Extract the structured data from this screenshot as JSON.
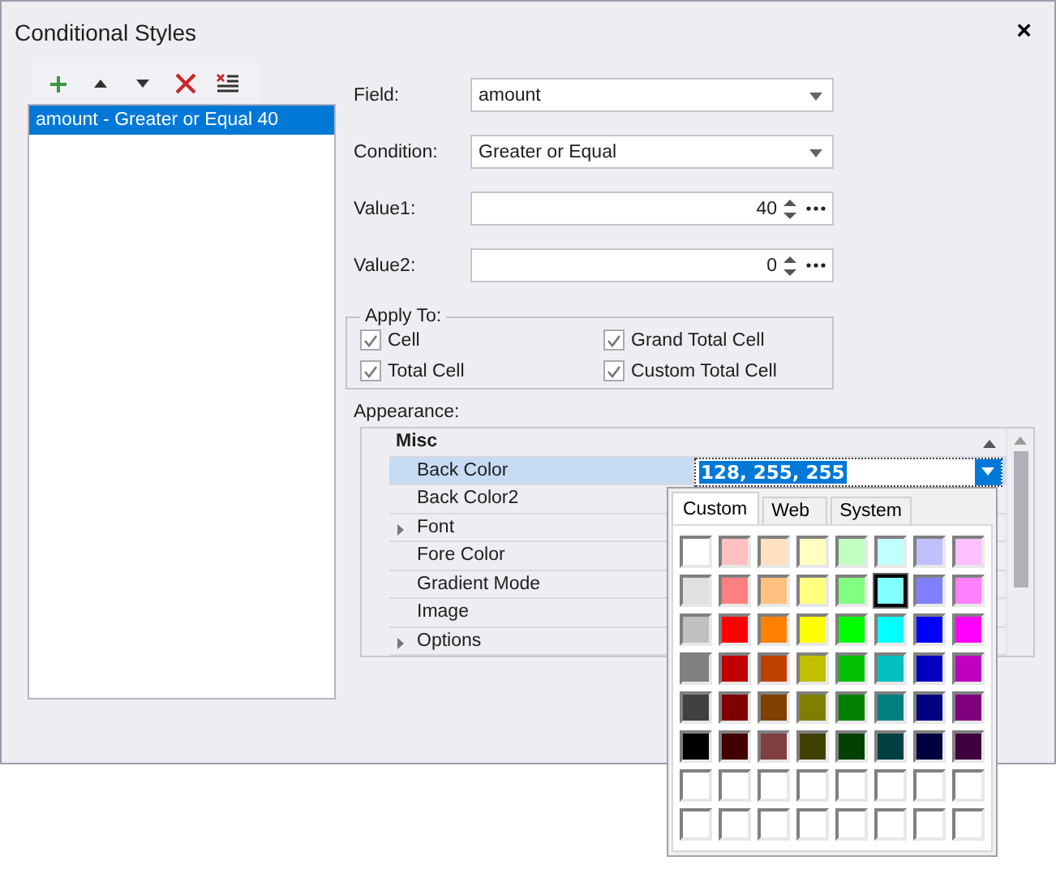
{
  "window": {
    "title": "Conditional Styles",
    "close": "×"
  },
  "toolbar": [
    {
      "kind": "add"
    },
    {
      "kind": "up"
    },
    {
      "kind": "down"
    },
    {
      "kind": "delete"
    },
    {
      "kind": "clear"
    }
  ],
  "rules": [
    {
      "label": "amount - Greater or Equal 40",
      "selected": true
    }
  ],
  "fields": [
    {
      "label": "Field:",
      "kind": "combo",
      "value": "amount"
    },
    {
      "label": "Condition:",
      "kind": "combo",
      "value": "Greater or Equal"
    },
    {
      "label": "Value1:",
      "kind": "spin",
      "value": "40"
    },
    {
      "label": "Value2:",
      "kind": "spin",
      "value": "0"
    }
  ],
  "apply_to": {
    "title": "Apply To:",
    "options": [
      {
        "label": "Cell",
        "checked": true
      },
      {
        "label": "Grand Total Cell",
        "checked": true
      },
      {
        "label": "Total Cell",
        "checked": true
      },
      {
        "label": "Custom Total Cell",
        "checked": true
      }
    ]
  },
  "appearance": {
    "label": "Appearance:",
    "category": {
      "label": "Misc",
      "expanded": true
    },
    "rows": [
      {
        "label": "Back Color",
        "selected": true,
        "expandable": false,
        "value": "128, 255, 255"
      },
      {
        "label": "Back Color2",
        "selected": false,
        "expandable": false
      },
      {
        "label": "Font",
        "selected": false,
        "expandable": true
      },
      {
        "label": "Fore Color",
        "selected": false,
        "expandable": false
      },
      {
        "label": "Gradient Mode",
        "selected": false,
        "expandable": false
      },
      {
        "label": "Image",
        "selected": false,
        "expandable": false
      },
      {
        "label": "Options",
        "selected": false,
        "expandable": true
      }
    ]
  },
  "color_popup": {
    "tabs": [
      {
        "label": "Custom",
        "selected": true
      },
      {
        "label": "Web",
        "selected": false
      },
      {
        "label": "System",
        "selected": false
      }
    ],
    "swatches": [
      [
        {
          "color": "#ffffff",
          "selected": false
        },
        {
          "color": "#ffc0c0",
          "selected": false
        },
        {
          "color": "#ffe0c0",
          "selected": false
        },
        {
          "color": "#ffffc0",
          "selected": false
        },
        {
          "color": "#c0ffc0",
          "selected": false
        },
        {
          "color": "#c0ffff",
          "selected": false
        },
        {
          "color": "#c0c0ff",
          "selected": false
        },
        {
          "color": "#ffc0ff",
          "selected": false
        }
      ],
      [
        {
          "color": "#e0e0e0",
          "selected": false
        },
        {
          "color": "#ff8080",
          "selected": false
        },
        {
          "color": "#ffc080",
          "selected": false
        },
        {
          "color": "#ffff80",
          "selected": false
        },
        {
          "color": "#80ff80",
          "selected": false
        },
        {
          "color": "#80ffff",
          "selected": true
        },
        {
          "color": "#8080ff",
          "selected": false
        },
        {
          "color": "#ff80ff",
          "selected": false
        }
      ],
      [
        {
          "color": "#c0c0c0",
          "selected": false
        },
        {
          "color": "#ff0000",
          "selected": false
        },
        {
          "color": "#ff8000",
          "selected": false
        },
        {
          "color": "#ffff00",
          "selected": false
        },
        {
          "color": "#00ff00",
          "selected": false
        },
        {
          "color": "#00ffff",
          "selected": false
        },
        {
          "color": "#0000ff",
          "selected": false
        },
        {
          "color": "#ff00ff",
          "selected": false
        }
      ],
      [
        {
          "color": "#808080",
          "selected": false
        },
        {
          "color": "#c00000",
          "selected": false
        },
        {
          "color": "#c04000",
          "selected": false
        },
        {
          "color": "#c0c000",
          "selected": false
        },
        {
          "color": "#00c000",
          "selected": false
        },
        {
          "color": "#00c0c0",
          "selected": false
        },
        {
          "color": "#0000c0",
          "selected": false
        },
        {
          "color": "#c000c0",
          "selected": false
        }
      ],
      [
        {
          "color": "#404040",
          "selected": false
        },
        {
          "color": "#800000",
          "selected": false
        },
        {
          "color": "#804000",
          "selected": false
        },
        {
          "color": "#808000",
          "selected": false
        },
        {
          "color": "#008000",
          "selected": false
        },
        {
          "color": "#008080",
          "selected": false
        },
        {
          "color": "#000080",
          "selected": false
        },
        {
          "color": "#800080",
          "selected": false
        }
      ],
      [
        {
          "color": "#000000",
          "selected": false
        },
        {
          "color": "#400000",
          "selected": false
        },
        {
          "color": "#804040",
          "selected": false
        },
        {
          "color": "#404000",
          "selected": false
        },
        {
          "color": "#004000",
          "selected": false
        },
        {
          "color": "#004040",
          "selected": false
        },
        {
          "color": "#000040",
          "selected": false
        },
        {
          "color": "#400040",
          "selected": false
        }
      ],
      [
        {
          "color": "#ffffff",
          "selected": false
        },
        {
          "color": "#ffffff",
          "selected": false
        },
        {
          "color": "#ffffff",
          "selected": false
        },
        {
          "color": "#ffffff",
          "selected": false
        },
        {
          "color": "#ffffff",
          "selected": false
        },
        {
          "color": "#ffffff",
          "selected": false
        },
        {
          "color": "#ffffff",
          "selected": false
        },
        {
          "color": "#ffffff",
          "selected": false
        }
      ],
      [
        {
          "color": "#ffffff",
          "selected": false
        },
        {
          "color": "#ffffff",
          "selected": false
        },
        {
          "color": "#ffffff",
          "selected": false
        },
        {
          "color": "#ffffff",
          "selected": false
        },
        {
          "color": "#ffffff",
          "selected": false
        },
        {
          "color": "#ffffff",
          "selected": false
        },
        {
          "color": "#ffffff",
          "selected": false
        },
        {
          "color": "#ffffff",
          "selected": false
        }
      ]
    ]
  }
}
